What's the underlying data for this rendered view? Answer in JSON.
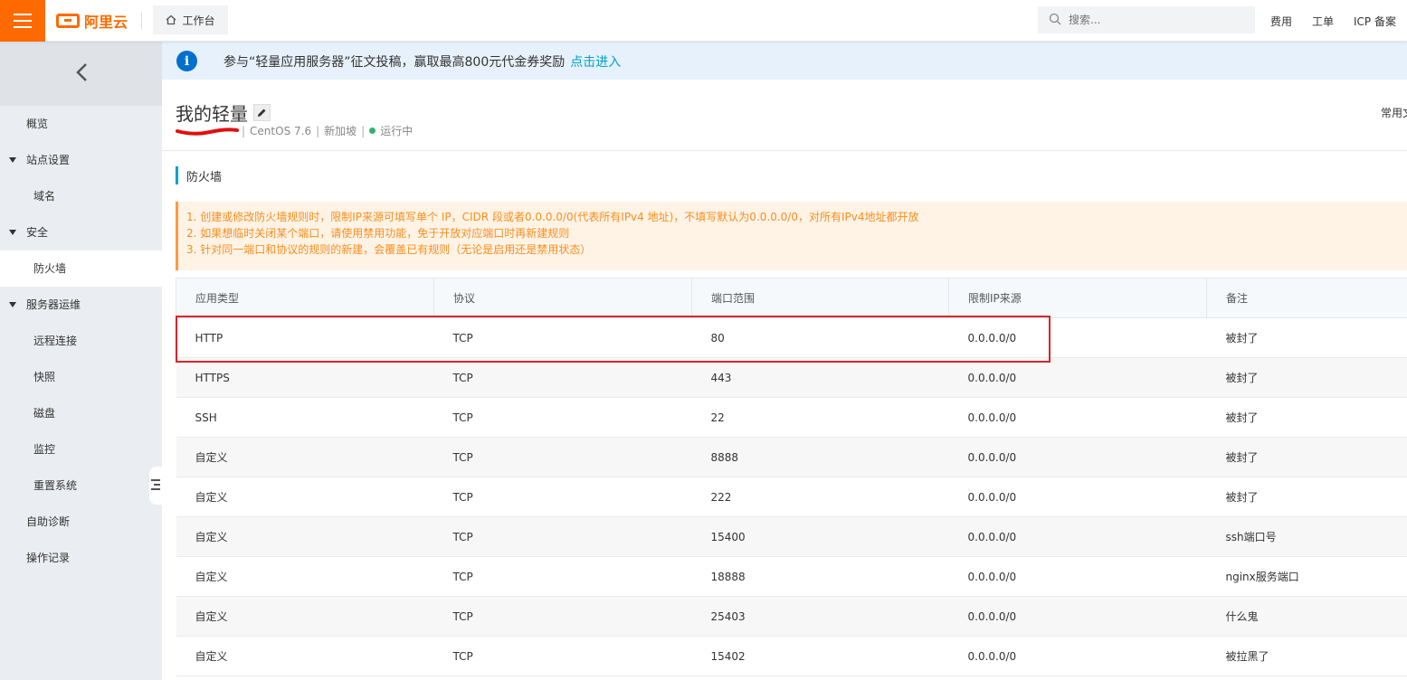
{
  "topbar": {
    "logo_text": "阿里云",
    "workbench_label": "工作台",
    "search_placeholder": "搜索...",
    "links": [
      "费用",
      "工单",
      "ICP 备案"
    ],
    "brand_color": "#ff6a00"
  },
  "sidebar": {
    "items": [
      {
        "label": "概览",
        "level": 1,
        "caret": false,
        "active": false
      },
      {
        "label": "站点设置",
        "level": 1,
        "caret": true,
        "active": false
      },
      {
        "label": "域名",
        "level": 2,
        "caret": false,
        "active": false
      },
      {
        "label": "安全",
        "level": 1,
        "caret": true,
        "active": false
      },
      {
        "label": "防火墙",
        "level": 2,
        "caret": false,
        "active": true
      },
      {
        "label": "服务器运维",
        "level": 1,
        "caret": true,
        "active": false
      },
      {
        "label": "远程连接",
        "level": 2,
        "caret": false,
        "active": false
      },
      {
        "label": "快照",
        "level": 2,
        "caret": false,
        "active": false
      },
      {
        "label": "磁盘",
        "level": 2,
        "caret": false,
        "active": false
      },
      {
        "label": "监控",
        "level": 2,
        "caret": false,
        "active": false
      },
      {
        "label": "重置系统",
        "level": 2,
        "caret": false,
        "active": false
      },
      {
        "label": "自助诊断",
        "level": 1,
        "caret": false,
        "active": false
      },
      {
        "label": "操作记录",
        "level": 1,
        "caret": false,
        "active": false
      }
    ]
  },
  "notice": {
    "text": "参与“轻量应用服务器”征文投稿，赢取最高800元代金券奖励",
    "link": "点击进入"
  },
  "instance": {
    "title": "我的轻量",
    "os": "CentOS 7.6",
    "region": "新加坡",
    "status": "运行中",
    "right_link": "常用文"
  },
  "section": {
    "title": "防火墙"
  },
  "warnings": [
    "1. 创建或修改防火墙规则时，限制IP来源可填写单个 IP，CIDR 段或者0.0.0.0/0(代表所有IPv4 地址)，不填写默认为0.0.0.0/0，对所有IPv4地址都开放",
    "2. 如果想临时关闭某个端口，请使用禁用功能，免于开放对应端口时再新建规则",
    "3. 针对同一端口和协议的规则的新建，会覆盖已有规则（无论是启用还是禁用状态）"
  ],
  "table": {
    "headers": [
      "应用类型",
      "协议",
      "端口范围",
      "限制IP来源",
      "备注"
    ],
    "rows": [
      [
        "HTTP",
        "TCP",
        "80",
        "0.0.0.0/0",
        "被封了"
      ],
      [
        "HTTPS",
        "TCP",
        "443",
        "0.0.0.0/0",
        "被封了"
      ],
      [
        "SSH",
        "TCP",
        "22",
        "0.0.0.0/0",
        "被封了"
      ],
      [
        "自定义",
        "TCP",
        "8888",
        "0.0.0.0/0",
        "被封了"
      ],
      [
        "自定义",
        "TCP",
        "222",
        "0.0.0.0/0",
        "被封了"
      ],
      [
        "自定义",
        "TCP",
        "15400",
        "0.0.0.0/0",
        "ssh端口号"
      ],
      [
        "自定义",
        "TCP",
        "18888",
        "0.0.0.0/0",
        "nginx服务端口"
      ],
      [
        "自定义",
        "TCP",
        "25403",
        "0.0.0.0/0",
        "什么鬼"
      ],
      [
        "自定义",
        "TCP",
        "15402",
        "0.0.0.0/0",
        "被拉黑了"
      ]
    ]
  }
}
